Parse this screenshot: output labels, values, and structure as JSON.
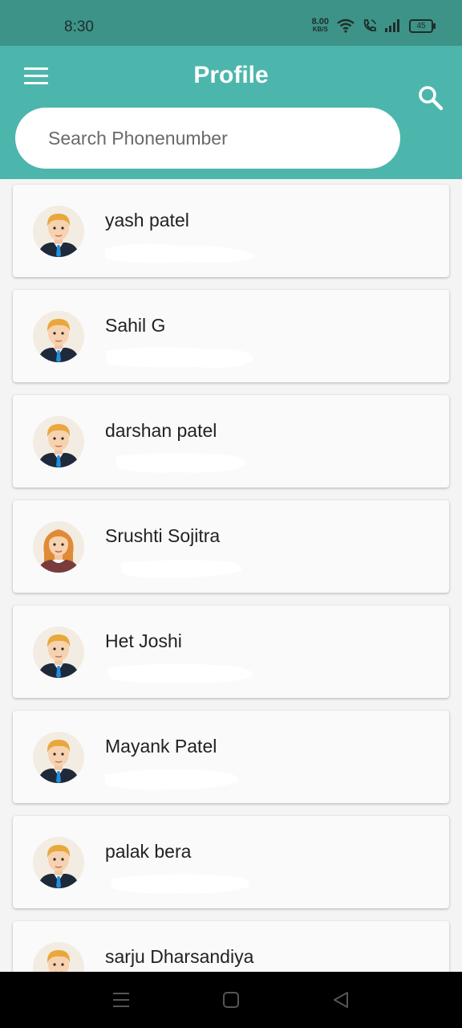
{
  "status_bar": {
    "time": "8:30",
    "net_speed_value": "8.00",
    "net_speed_unit": "KB/S",
    "battery": "45"
  },
  "app_bar": {
    "title": "Profile",
    "menu_icon": "hamburger-menu-icon",
    "search_icon": "magnifier-icon"
  },
  "search": {
    "placeholder": "Search Phonenumber",
    "value": ""
  },
  "profiles": [
    {
      "name": "yash patel",
      "avatar": "male"
    },
    {
      "name": "Sahil G",
      "avatar": "male"
    },
    {
      "name": "darshan patel",
      "avatar": "male"
    },
    {
      "name": "Srushti Sojitra",
      "avatar": "female"
    },
    {
      "name": "Het Joshi",
      "avatar": "male"
    },
    {
      "name": "Mayank Patel",
      "avatar": "male"
    },
    {
      "name": "palak bera",
      "avatar": "male"
    },
    {
      "name": "sarju Dharsandiya",
      "avatar": "male"
    }
  ],
  "colors": {
    "app_bar": "#4db6ac",
    "status_bar": "#3d9388",
    "nav_bar": "#000000"
  }
}
